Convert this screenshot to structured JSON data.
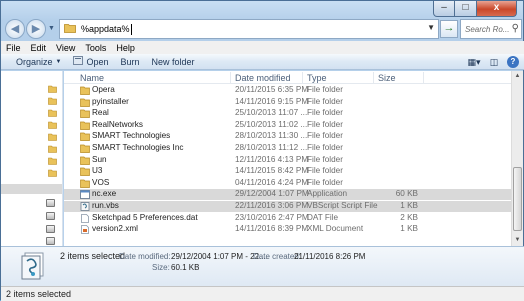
{
  "window": {
    "controls": {
      "minimize": "–",
      "maximize": "□",
      "close": "x"
    }
  },
  "address": {
    "value": "%appdata%",
    "go": "→",
    "search_placeholder": "Search Ro..."
  },
  "menu": [
    "File",
    "Edit",
    "View",
    "Tools",
    "Help"
  ],
  "toolbar": {
    "organize": "Organize",
    "open": "Open",
    "burn": "Burn",
    "new_folder": "New folder"
  },
  "columns": {
    "name": "Name",
    "date": "Date modified",
    "type": "Type",
    "size": "Size"
  },
  "files": [
    {
      "name": "Opera",
      "date": "20/11/2015 6:35 PM",
      "type": "File folder",
      "size": "",
      "icon": "folder-icon",
      "selected": false
    },
    {
      "name": "pyinstaller",
      "date": "14/11/2016 9:15 PM",
      "type": "File folder",
      "size": "",
      "icon": "folder-icon",
      "selected": false
    },
    {
      "name": "Real",
      "date": "25/10/2013 11:07 ...",
      "type": "File folder",
      "size": "",
      "icon": "folder-icon",
      "selected": false
    },
    {
      "name": "RealNetworks",
      "date": "25/10/2013 11:02 ...",
      "type": "File folder",
      "size": "",
      "icon": "folder-icon",
      "selected": false
    },
    {
      "name": "SMART Technologies",
      "date": "28/10/2013 11:30 ...",
      "type": "File folder",
      "size": "",
      "icon": "folder-icon",
      "selected": false
    },
    {
      "name": "SMART Technologies Inc",
      "date": "28/10/2013 11:12 ...",
      "type": "File folder",
      "size": "",
      "icon": "folder-icon",
      "selected": false
    },
    {
      "name": "Sun",
      "date": "12/11/2016 4:13 PM",
      "type": "File folder",
      "size": "",
      "icon": "folder-icon",
      "selected": false
    },
    {
      "name": "U3",
      "date": "14/11/2015 8:42 PM",
      "type": "File folder",
      "size": "",
      "icon": "folder-icon",
      "selected": false
    },
    {
      "name": "VOS",
      "date": "04/11/2016 4:24 PM",
      "type": "File folder",
      "size": "",
      "icon": "folder-icon",
      "selected": false
    },
    {
      "name": "nc.exe",
      "date": "29/12/2004 1:07 PM",
      "type": "Application",
      "size": "60 KB",
      "icon": "application-icon",
      "selected": true
    },
    {
      "name": "run.vbs",
      "date": "22/11/2016 3:06 PM",
      "type": "VBScript Script File",
      "size": "1 KB",
      "icon": "script-icon",
      "selected": true
    },
    {
      "name": "Sketchpad 5 Preferences.dat",
      "date": "23/10/2016 2:47 PM",
      "type": "DAT File",
      "size": "2 KB",
      "icon": "file-icon",
      "selected": false
    },
    {
      "name": "version2.xml",
      "date": "14/11/2016 8:39 PM",
      "type": "XML Document",
      "size": "1 KB",
      "icon": "xml-file-icon",
      "selected": false
    }
  ],
  "details": {
    "summary": "2 items selected",
    "date_modified_label": "Date modified:",
    "date_modified_value": "29/12/2004 1:07 PM - 22....",
    "date_created_label": "Date created:",
    "date_created_value": "21/11/2016 8:26 PM",
    "size_label": "Size:",
    "size_value": "60.1 KB"
  },
  "status": "2 items selected"
}
